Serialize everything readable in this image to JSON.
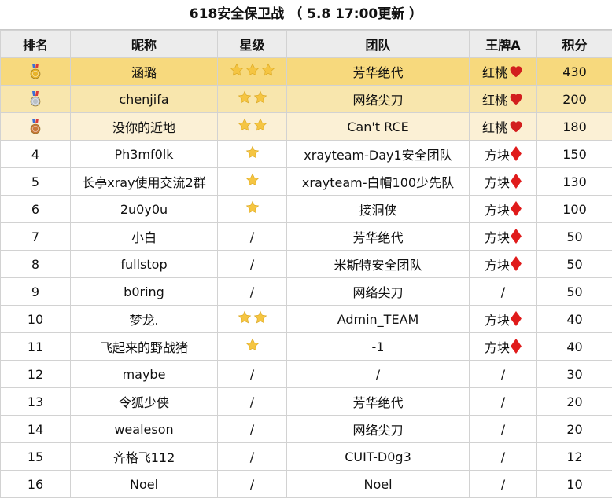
{
  "title": "618安全保卫战 （ 5.8 17:00更新 ）",
  "headers": {
    "rank": "排名",
    "nick": "昵称",
    "stars": "星级",
    "team": "团队",
    "ace": "王牌A",
    "score": "积分"
  },
  "colors": {
    "gold_row": "#f7d97d",
    "silver_row": "#f8e6ad",
    "bronze_row": "#fbf0d5",
    "header_bg": "#ececec",
    "star": "#f5c542",
    "heart": "#d21e1e",
    "diamond": "#e01b1b"
  },
  "rows": [
    {
      "rank": "",
      "medal": "gold-medal-icon",
      "nick": "涵璐",
      "stars": 3,
      "stars_text": "",
      "team": "芳华绝代",
      "ace": "红桃",
      "suit": "heart",
      "score": "430"
    },
    {
      "rank": "",
      "medal": "silver-medal-icon",
      "nick": "chenjifa",
      "stars": 2,
      "stars_text": "",
      "team": "网络尖刀",
      "ace": "红桃",
      "suit": "heart",
      "score": "200"
    },
    {
      "rank": "",
      "medal": "bronze-medal-icon",
      "nick": "没你的近地",
      "stars": 2,
      "stars_text": "",
      "team": "Can't RCE",
      "ace": "红桃",
      "suit": "heart",
      "score": "180"
    },
    {
      "rank": "4",
      "nick": "Ph3mf0lk",
      "stars": 1,
      "stars_text": "",
      "team": "xrayteam-Day1安全团队",
      "ace": "方块",
      "suit": "diamond",
      "score": "150"
    },
    {
      "rank": "5",
      "nick": "长亭xray使用交流2群",
      "stars": 1,
      "stars_text": "",
      "team": "xrayteam-白帽100少先队",
      "ace": "方块",
      "suit": "diamond",
      "score": "130"
    },
    {
      "rank": "6",
      "nick": "2u0y0u",
      "stars": 1,
      "stars_text": "",
      "team": "接洞侠",
      "ace": "方块",
      "suit": "diamond",
      "score": "100"
    },
    {
      "rank": "7",
      "nick": "小白",
      "stars": 0,
      "stars_text": "/",
      "team": "芳华绝代",
      "ace": "方块",
      "suit": "diamond",
      "score": "50"
    },
    {
      "rank": "8",
      "nick": "fullstop",
      "stars": 0,
      "stars_text": "/",
      "team": "米斯特安全团队",
      "ace": "方块",
      "suit": "diamond",
      "score": "50"
    },
    {
      "rank": "9",
      "nick": "b0ring",
      "stars": 0,
      "stars_text": "/",
      "team": "网络尖刀",
      "ace": "/",
      "suit": "",
      "score": "50"
    },
    {
      "rank": "10",
      "nick": "梦龙.",
      "stars": 2,
      "stars_text": "",
      "team": "Admin_TEAM",
      "ace": "方块",
      "suit": "diamond",
      "score": "40"
    },
    {
      "rank": "11",
      "nick": "飞起来的野战猪",
      "stars": 1,
      "stars_text": "",
      "team": "-1",
      "ace": "方块",
      "suit": "diamond",
      "score": "40"
    },
    {
      "rank": "12",
      "nick": "maybe",
      "stars": 0,
      "stars_text": "/",
      "team": "/",
      "ace": "/",
      "suit": "",
      "score": "30"
    },
    {
      "rank": "13",
      "nick": "令狐少侠",
      "stars": 0,
      "stars_text": "/",
      "team": "芳华绝代",
      "ace": "/",
      "suit": "",
      "score": "20"
    },
    {
      "rank": "14",
      "nick": "wealeson",
      "stars": 0,
      "stars_text": "/",
      "team": "网络尖刀",
      "ace": "/",
      "suit": "",
      "score": "20"
    },
    {
      "rank": "15",
      "nick": "齐格飞112",
      "stars": 0,
      "stars_text": "/",
      "team": "CUIT-D0g3",
      "ace": "/",
      "suit": "",
      "score": "12"
    },
    {
      "rank": "16",
      "nick": "Noel",
      "stars": 0,
      "stars_text": "/",
      "team": "Noel",
      "ace": "/",
      "suit": "",
      "score": "10"
    }
  ]
}
